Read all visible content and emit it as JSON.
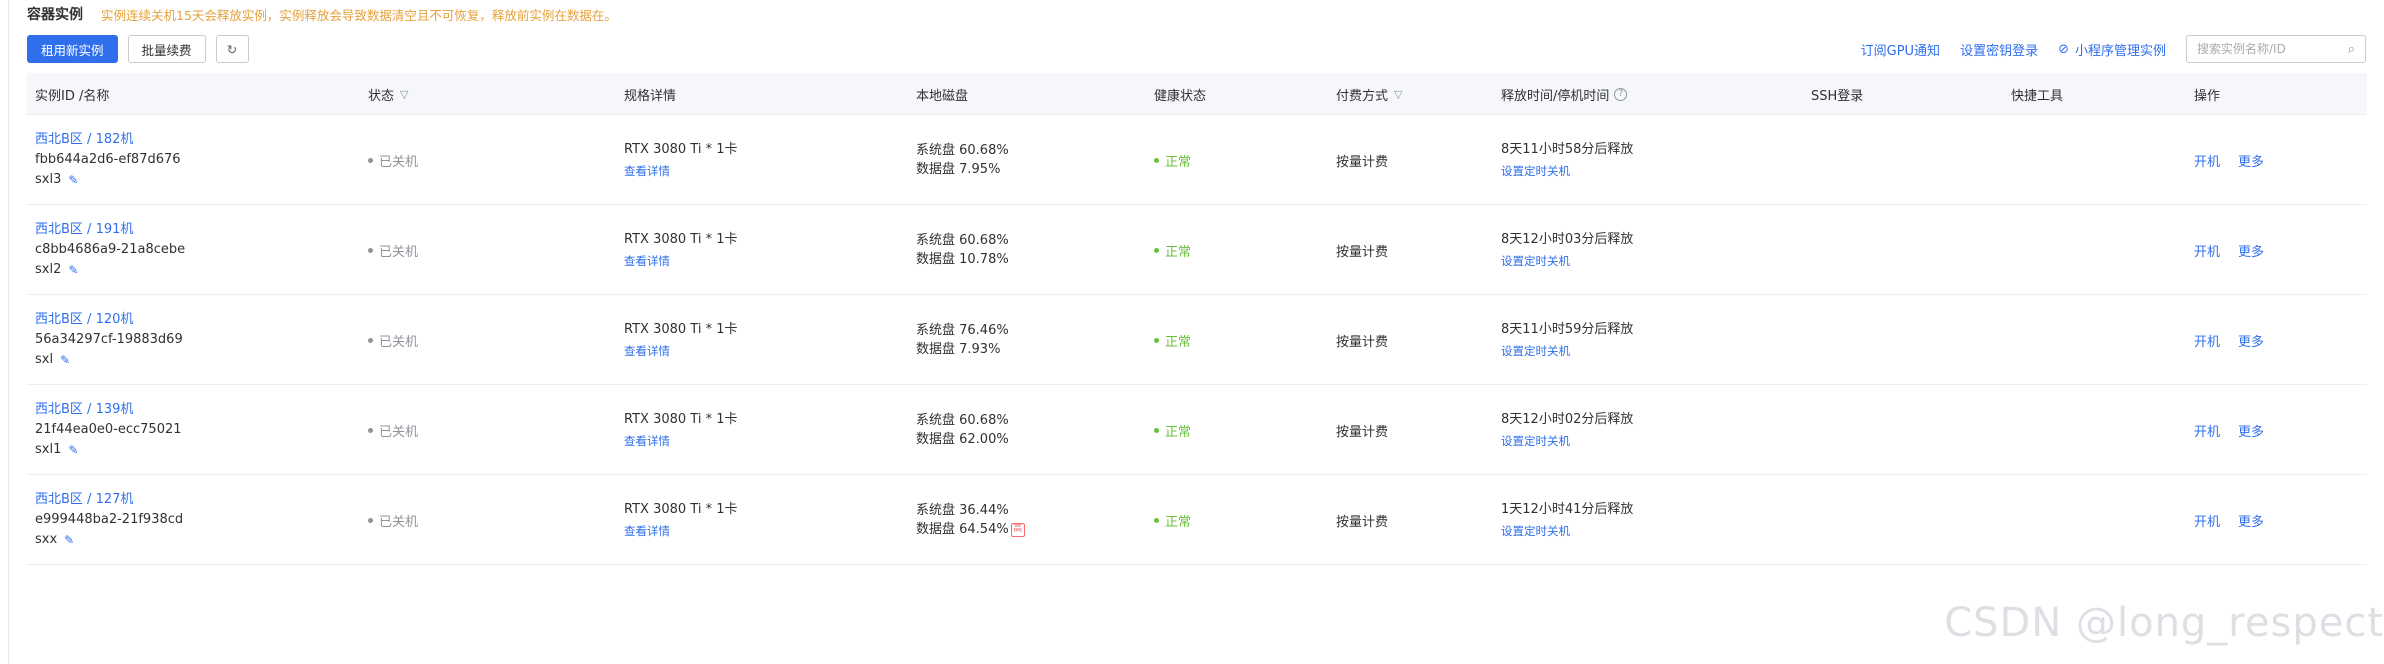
{
  "header": {
    "title": "容器实例",
    "warning": "实例连续关机15天会释放实例，实例释放会导致数据清空且不可恢复，释放前实例在数据在。"
  },
  "toolbar": {
    "rent_label": "租用新实例",
    "batch_renew_label": "批量续费",
    "refresh_icon": "refresh-icon",
    "subscribe_gpu_label": "订阅GPU通知",
    "ssh_key_label": "设置密钥登录",
    "miniapp_label": "小程序管理实例",
    "search_placeholder": "搜索实例名称/ID"
  },
  "columns": {
    "id_name": "实例ID /名称",
    "status": "状态",
    "spec": "规格详情",
    "disk": "本地磁盘",
    "health": "健康状态",
    "billing": "付费方式",
    "release": "释放时间/停机时间",
    "ssh": "SSH登录",
    "tools": "快捷工具",
    "actions": "操作"
  },
  "rows": [
    {
      "region": "西北B区 / 182机",
      "id": "fbb644a2d6-ef87d676",
      "name": "sxl3",
      "status": "已关机",
      "spec": "RTX 3080 Ti * 1卡",
      "spec_link": "查看详情",
      "sys_disk": "系统盘 60.68%",
      "data_disk": "数据盘 7.95%",
      "data_disk_warn": "",
      "health": "正常",
      "billing": "按量计费",
      "release": "8天11小时58分后释放",
      "release_link": "设置定时关机",
      "op_start": "开机",
      "op_more": "更多"
    },
    {
      "region": "西北B区 / 191机",
      "id": "c8bb4686a9-21a8cebe",
      "name": "sxl2",
      "status": "已关机",
      "spec": "RTX 3080 Ti * 1卡",
      "spec_link": "查看详情",
      "sys_disk": "系统盘 60.68%",
      "data_disk": "数据盘 10.78%",
      "data_disk_warn": "",
      "health": "正常",
      "billing": "按量计费",
      "release": "8天12小时03分后释放",
      "release_link": "设置定时关机",
      "op_start": "开机",
      "op_more": "更多"
    },
    {
      "region": "西北B区 / 120机",
      "id": "56a34297cf-19883d69",
      "name": "sxl",
      "status": "已关机",
      "spec": "RTX 3080 Ti * 1卡",
      "spec_link": "查看详情",
      "sys_disk": "系统盘 76.46%",
      "data_disk": "数据盘 7.93%",
      "data_disk_warn": "",
      "health": "正常",
      "billing": "按量计费",
      "release": "8天11小时59分后释放",
      "release_link": "设置定时关机",
      "op_start": "开机",
      "op_more": "更多"
    },
    {
      "region": "西北B区 / 139机",
      "id": "21f44ea0e0-ecc75021",
      "name": "sxl1",
      "status": "已关机",
      "spec": "RTX 3080 Ti * 1卡",
      "spec_link": "查看详情",
      "sys_disk": "系统盘 60.68%",
      "data_disk": "数据盘 62.00%",
      "data_disk_warn": "",
      "health": "正常",
      "billing": "按量计费",
      "release": "8天12小时02分后释放",
      "release_link": "设置定时关机",
      "op_start": "开机",
      "op_more": "更多"
    },
    {
      "region": "西北B区 / 127机",
      "id": "e999448ba2-21f938cd",
      "name": "sxx",
      "status": "已关机",
      "spec": "RTX 3080 Ti * 1卡",
      "spec_link": "查看详情",
      "sys_disk": "系统盘 36.44%",
      "data_disk": "数据盘 64.54%",
      "data_disk_warn": "高",
      "health": "正常",
      "billing": "按量计费",
      "release": "1天12小时41分后释放",
      "release_link": "设置定时关机",
      "op_start": "开机",
      "op_more": "更多"
    }
  ],
  "watermark": "CSDN @long_respect",
  "colors": {
    "primary": "#2f6fec",
    "warning": "#e6a23c",
    "healthy": "#67c23a",
    "muted": "#909399"
  }
}
